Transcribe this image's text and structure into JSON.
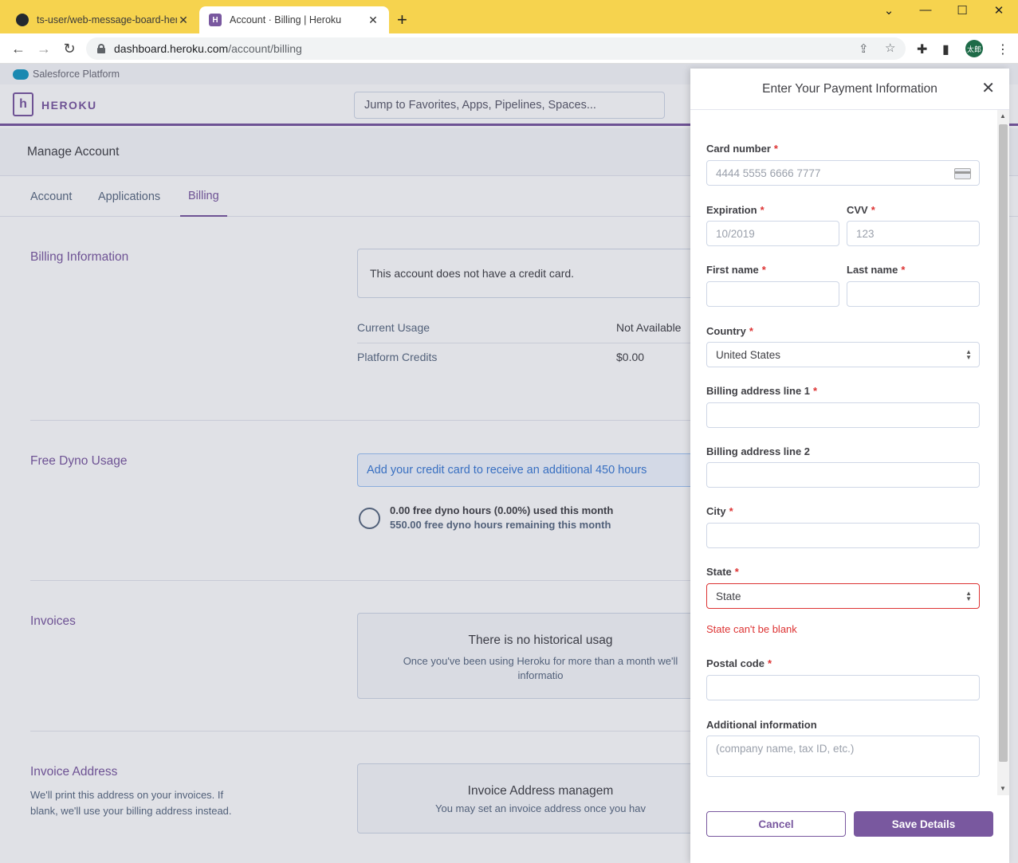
{
  "browser": {
    "tabs": [
      {
        "title": "ts-user/web-message-board-heroku"
      },
      {
        "title": "Account · Billing | Heroku"
      }
    ],
    "url_host": "dashboard.heroku.com",
    "url_path": "/account/billing",
    "profile_initials": "太郎"
  },
  "salesforce_bar": {
    "label": "Salesforce Platform"
  },
  "header": {
    "brand": "HEROKU",
    "search_placeholder": "Jump to Favorites, Apps, Pipelines, Spaces..."
  },
  "manage": {
    "title": "Manage Account"
  },
  "subnav": {
    "items": [
      "Account",
      "Applications",
      "Billing"
    ],
    "active": "Billing"
  },
  "billing_info": {
    "title": "Billing Information",
    "no_card": "This account does not have a credit card.",
    "rows": [
      {
        "label": "Current Usage",
        "value": "Not Available"
      },
      {
        "label": "Platform Credits",
        "value": "$0.00"
      }
    ]
  },
  "free_dyno": {
    "title": "Free Dyno Usage",
    "notice": "Add your credit card to receive an additional 450 hours",
    "used": "0.00 free dyno hours (0.00%) used this month",
    "remaining": "550.00 free dyno hours remaining this month"
  },
  "invoices": {
    "title": "Invoices",
    "heading": "There is no historical usag",
    "body_1": "Once you've been using Heroku for more than a month we'll",
    "body_2": "informatio"
  },
  "invoice_address": {
    "title": "Invoice Address",
    "desc": "We'll print this address on your invoices. If blank, we'll use your billing address instead.",
    "heading": "Invoice Address managem",
    "body": "You may set an invoice address once you hav"
  },
  "modal": {
    "title": "Enter Your Payment Information",
    "fields": {
      "card_number": {
        "label": "Card number",
        "placeholder": "4444 5555 6666 7777"
      },
      "expiration": {
        "label": "Expiration",
        "placeholder": "10/2019"
      },
      "cvv": {
        "label": "CVV",
        "placeholder": "123"
      },
      "first_name": {
        "label": "First name",
        "value": ""
      },
      "last_name": {
        "label": "Last name",
        "value": ""
      },
      "country": {
        "label": "Country",
        "value": "United States"
      },
      "address1": {
        "label": "Billing address line 1",
        "value": ""
      },
      "address2": {
        "label": "Billing address line 2",
        "value": ""
      },
      "city": {
        "label": "City",
        "value": ""
      },
      "state": {
        "label": "State",
        "value": "State",
        "error": "State can't be blank"
      },
      "postal": {
        "label": "Postal code",
        "value": ""
      },
      "additional": {
        "label": "Additional information",
        "placeholder": "(company name, tax ID, etc.)"
      }
    },
    "required_mark": "*",
    "cancel_label": "Cancel",
    "save_label": "Save Details"
  },
  "colors": {
    "brand": "#79589f",
    "chrome": "#f6d34e",
    "error": "#dd3333",
    "info": "#3a7ad4"
  }
}
